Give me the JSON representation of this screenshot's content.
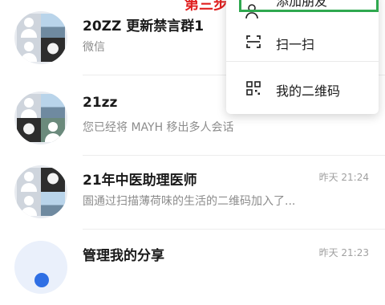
{
  "chats": [
    {
      "name": "20ZZ 更新禁言群1",
      "preview": "微信",
      "time": ""
    },
    {
      "name": "21zz",
      "preview": "您已经将 MAYH 移出多人会话",
      "time": ""
    },
    {
      "name": "21年中医助理医师",
      "preview": "圄通过扫描薄荷味的生活的二维码加入了...",
      "time": "昨天 21:24"
    },
    {
      "name": "管理我的分享",
      "preview": "",
      "time": "昨天 21:23"
    }
  ],
  "menu": {
    "items": [
      {
        "label": "添加朋友",
        "icon": "add-friend-icon"
      },
      {
        "label": "扫一扫",
        "icon": "scan-icon"
      },
      {
        "label": "我的二维码",
        "icon": "qr-code-icon"
      }
    ]
  },
  "annotation": {
    "text": "第三步"
  },
  "colors": {
    "highlight": "#2fa84f",
    "annotation": "#e02020"
  }
}
